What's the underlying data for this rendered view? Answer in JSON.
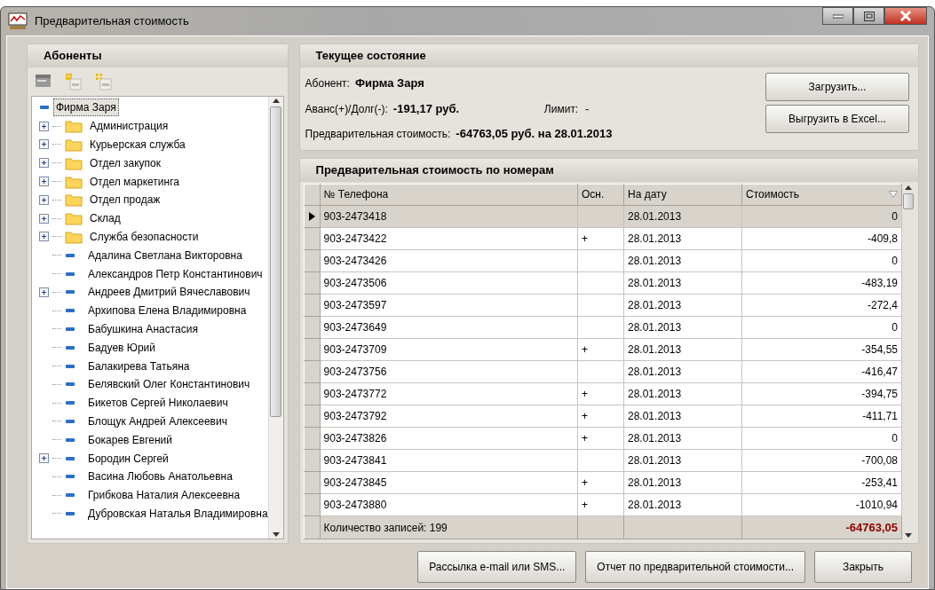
{
  "window": {
    "title": "Предварительная стоимость"
  },
  "subscribers": {
    "title": "Абоненты",
    "tree": [
      {
        "label": "Фирма Заря",
        "kind": "company",
        "selected": true,
        "children": [
          {
            "label": "Администрация",
            "kind": "folder",
            "expandable": true
          },
          {
            "label": "Курьерская служба",
            "kind": "folder",
            "expandable": true
          },
          {
            "label": "Отдел закупок",
            "kind": "folder",
            "expandable": true
          },
          {
            "label": "Отдел маркетинга",
            "kind": "folder",
            "expandable": true
          },
          {
            "label": "Отдел продаж",
            "kind": "folder",
            "expandable": true
          },
          {
            "label": "Склад",
            "kind": "folder",
            "expandable": true
          },
          {
            "label": "Служба безопасности",
            "kind": "folder",
            "expandable": true
          },
          {
            "label": "Адалина Светлана Викторовна",
            "kind": "person",
            "expandable": false
          },
          {
            "label": "Александров Петр Константинович",
            "kind": "person",
            "expandable": false
          },
          {
            "label": "Андреев Дмитрий Вячеславович",
            "kind": "person",
            "expandable": true
          },
          {
            "label": "Архипова Елена Владимировна",
            "kind": "person",
            "expandable": false
          },
          {
            "label": "Бабушкина Анастасия",
            "kind": "person",
            "expandable": false
          },
          {
            "label": "Бадуев Юрий",
            "kind": "person",
            "expandable": false
          },
          {
            "label": "Балакирева Татьяна",
            "kind": "person",
            "expandable": false
          },
          {
            "label": "Белявский Олег Константинович",
            "kind": "person",
            "expandable": false
          },
          {
            "label": "Бикетов Сергей Николаевич",
            "kind": "person",
            "expandable": false
          },
          {
            "label": "Блощук Андрей Алексеевич",
            "kind": "person",
            "expandable": false
          },
          {
            "label": "Бокарев Евгений",
            "kind": "person",
            "expandable": false
          },
          {
            "label": "Бородин Сергей",
            "kind": "person",
            "expandable": true
          },
          {
            "label": "Васина Любовь Анатольевна",
            "kind": "person",
            "expandable": false
          },
          {
            "label": "Грибкова Наталия Алексеевна",
            "kind": "person",
            "expandable": false
          },
          {
            "label": "Дубровская Наталья Владимировна",
            "kind": "person",
            "expandable": false
          }
        ]
      }
    ]
  },
  "current_state": {
    "title": "Текущее состояние",
    "subscriber_label": "Абонент:",
    "subscriber_value": "Фирма Заря",
    "balance_label": "Аванс(+)/Долг(-):",
    "balance_value": "-191,17 руб.",
    "limit_label": "Лимит:",
    "limit_value": "-",
    "estimate_label": "Предварительная стоимость:",
    "estimate_value": "-64763,05 руб. на 28.01.2013",
    "buttons": [
      "Загрузить...",
      "Выгрузить в Excel..."
    ]
  },
  "by_number": {
    "title": "Предварительная стоимость по номерам",
    "columns": [
      "№ Телефона",
      "Осн.",
      "На дату",
      "Стоимость"
    ],
    "rows": [
      {
        "phone": "903-2473418",
        "date": "28.01.2013",
        "cost": "0",
        "selected": true
      },
      {
        "phone": "903-2473422",
        "main": "+",
        "date": "28.01.2013",
        "cost": "-409,8",
        "selected": false
      },
      {
        "phone": "903-2473426",
        "date": "28.01.2013",
        "cost": "0",
        "selected": false
      },
      {
        "phone": "903-2473506",
        "date": "28.01.2013",
        "cost": "-483,19",
        "selected": false
      },
      {
        "phone": "903-2473597",
        "date": "28.01.2013",
        "cost": "-272,4",
        "selected": false
      },
      {
        "phone": "903-2473649",
        "date": "28.01.2013",
        "cost": "0",
        "selected": false
      },
      {
        "phone": "903-2473709",
        "main": "+",
        "date": "28.01.2013",
        "cost": "-354,55",
        "selected": false
      },
      {
        "phone": "903-2473756",
        "date": "28.01.2013",
        "cost": "-416,47",
        "selected": false
      },
      {
        "phone": "903-2473772",
        "main": "+",
        "date": "28.01.2013",
        "cost": "-394,75",
        "selected": false
      },
      {
        "phone": "903-2473792",
        "main": "+",
        "date": "28.01.2013",
        "cost": "-411,71",
        "selected": false
      },
      {
        "phone": "903-2473826",
        "main": "+",
        "date": "28.01.2013",
        "cost": "0",
        "selected": false
      },
      {
        "phone": "903-2473841",
        "date": "28.01.2013",
        "cost": "-700,08",
        "selected": false
      },
      {
        "phone": "903-2473845",
        "main": "+",
        "date": "28.01.2013",
        "cost": "-253,41",
        "selected": false
      },
      {
        "phone": "903-2473880",
        "main": "+",
        "date": "28.01.2013",
        "cost": "-1010,94",
        "selected": false
      }
    ],
    "footer": {
      "count": "Количество записей: 199",
      "total": "-64763,05"
    }
  },
  "buttons": [
    "Рассылка e-mail или SMS...",
    "Отчет по предварительной стоимости...",
    "Закрыть"
  ]
}
